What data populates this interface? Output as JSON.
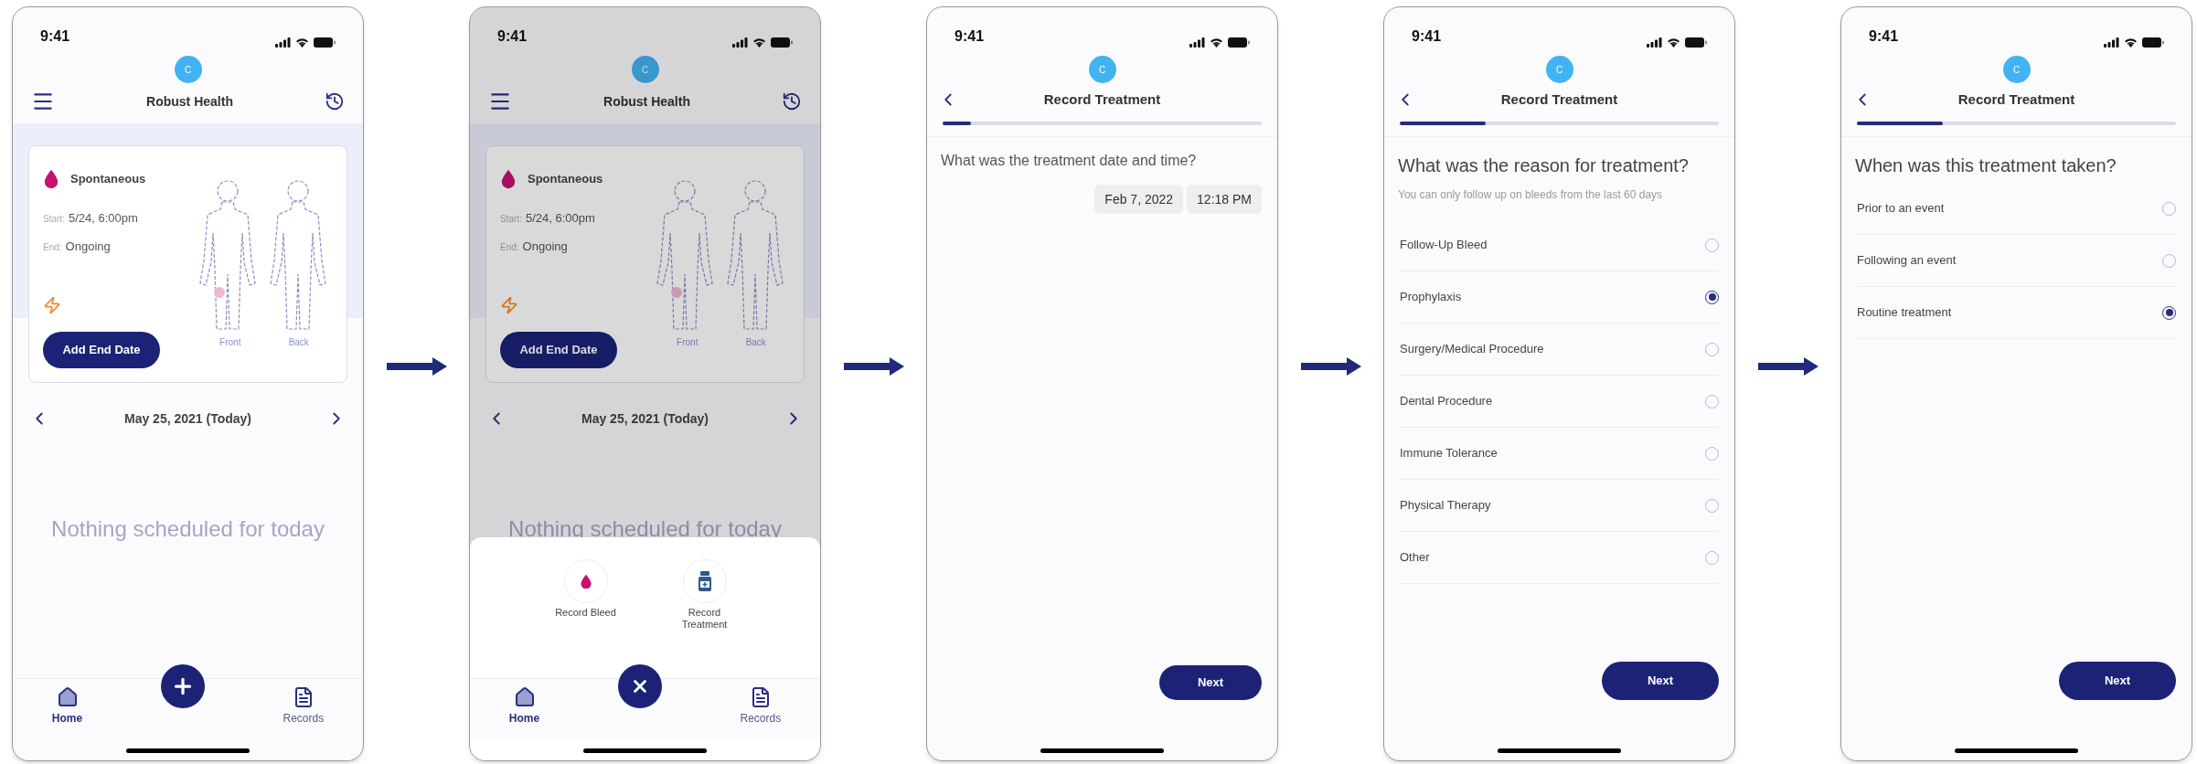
{
  "screens": [
    {
      "kind": "home",
      "status_time": "9:41",
      "avatar": "C",
      "title": "Robust Health",
      "event": {
        "type": "Spontaneous",
        "start_label": "Start:",
        "start": "5/24, 6:00pm",
        "end_label": "End:",
        "end": "Ongoing",
        "button": "Add End Date",
        "front_label": "Front",
        "back_label": "Back"
      },
      "date": "May 25, 2021 (Today)",
      "empty_message": "Nothing scheduled for today",
      "nav": [
        {
          "label": "Home",
          "selected": true
        },
        {
          "label": "Records",
          "selected": false
        }
      ],
      "menu_open": false
    },
    {
      "kind": "home",
      "status_time": "9:41",
      "avatar": "C",
      "title": "Robust Health",
      "event": {
        "type": "Spontaneous",
        "start_label": "Start:",
        "start": "5/24, 6:00pm",
        "end_label": "End:",
        "end": "Ongoing",
        "button": "Add End Date",
        "front_label": "Front",
        "back_label": "Back"
      },
      "date": "May 25, 2021 (Today)",
      "empty_message": "Nothing scheduled for today",
      "nav": [
        {
          "label": "Home",
          "selected": true
        },
        {
          "label": "Records",
          "selected": false
        }
      ],
      "menu_open": true,
      "actions": [
        {
          "kind": "bleed",
          "label": "Record Bleed"
        },
        {
          "kind": "treatment",
          "label": "Record Treatment"
        }
      ]
    },
    {
      "kind": "datetime",
      "status_time": "9:41",
      "avatar": "C",
      "title": "Record Treatment",
      "progress": {
        "level": 0.09
      },
      "question": "What was the treatment date and time?",
      "date": "Feb 7, 2022",
      "time": "12:18 PM",
      "next": "Next"
    },
    {
      "kind": "choice",
      "status_time": "9:41",
      "avatar": "C",
      "title": "Record Treatment",
      "progress": {
        "level": 0.27
      },
      "question": "What was the reason for treatment?",
      "hint": "You can only follow up on bleeds from the last 60 days",
      "options": [
        {
          "label": "Follow-Up Bleed",
          "selected": false
        },
        {
          "label": "Prophylaxis",
          "selected": true
        },
        {
          "label": "Surgery/Medical Procedure",
          "selected": false
        },
        {
          "label": "Dental Procedure",
          "selected": false
        },
        {
          "label": "Immune Tolerance",
          "selected": false
        },
        {
          "label": "Physical Therapy",
          "selected": false
        },
        {
          "label": "Other",
          "selected": false
        }
      ],
      "next": "Next"
    },
    {
      "kind": "choice",
      "status_time": "9:41",
      "avatar": "C",
      "title": "Record Treatment",
      "progress": {
        "level": 0.27
      },
      "question": "When was this treatment taken?",
      "options": [
        {
          "label": "Prior to an event",
          "selected": false
        },
        {
          "label": "Following an event",
          "selected": false
        },
        {
          "label": "Routine treatment",
          "selected": true
        }
      ],
      "next": "Next"
    }
  ]
}
